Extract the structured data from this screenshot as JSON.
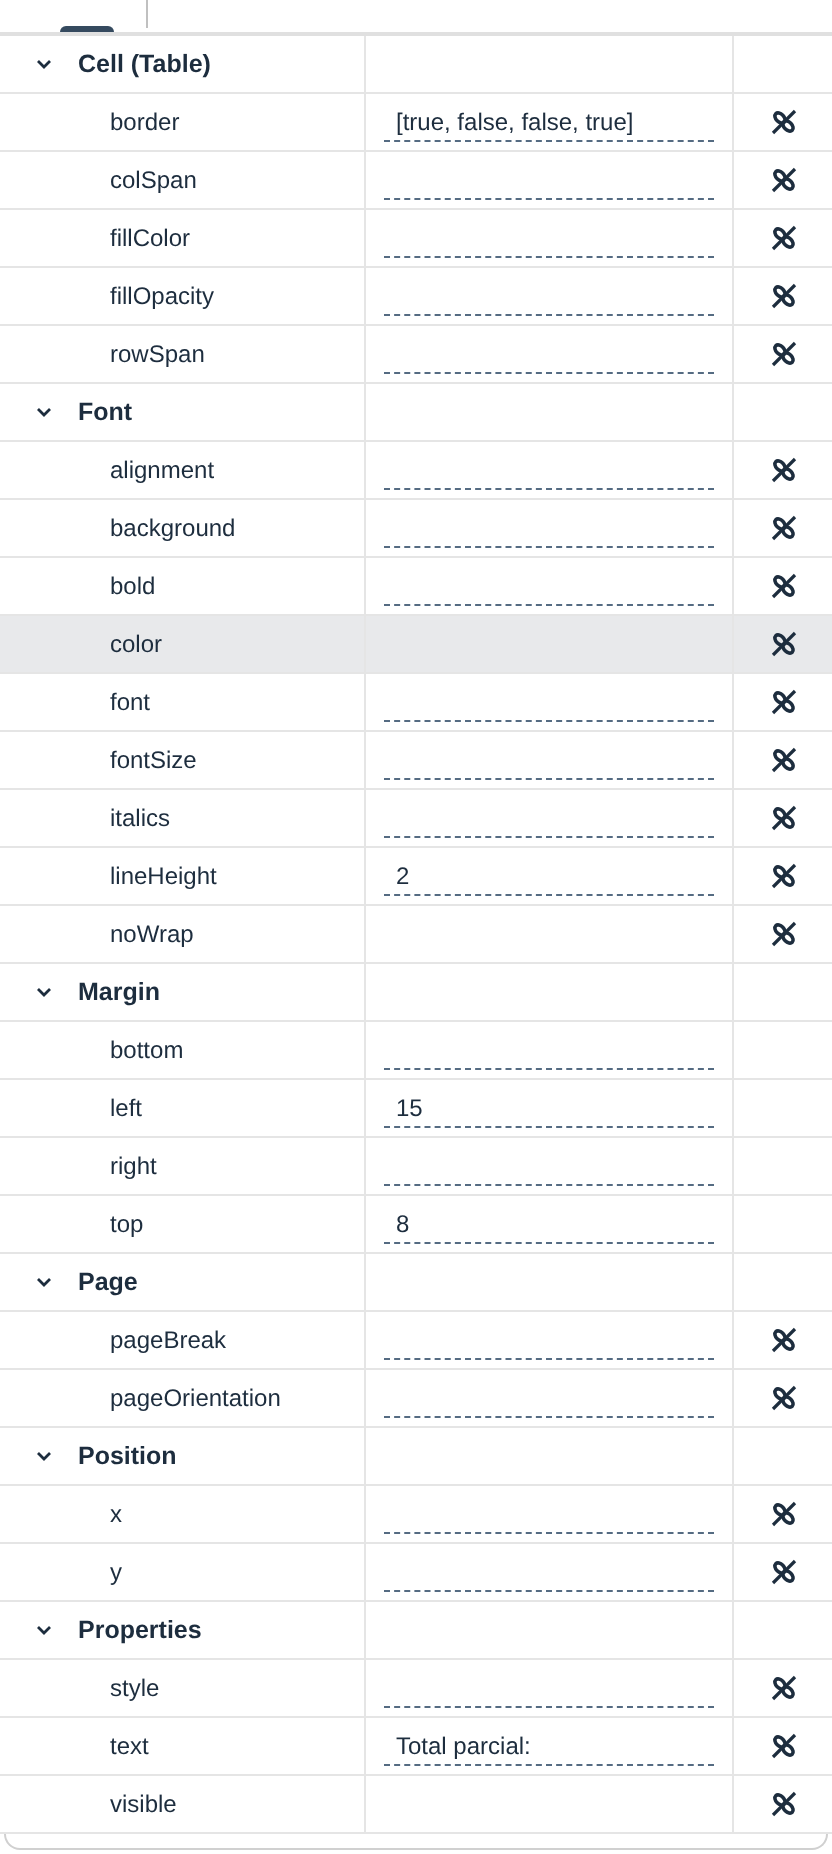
{
  "groups": [
    {
      "title": "Cell (Table)",
      "expanded": true,
      "properties": [
        {
          "name": "border",
          "kind": "field",
          "value": "[true, false, false, true]",
          "bound": true,
          "selected": false
        },
        {
          "name": "colSpan",
          "kind": "field",
          "bound": true,
          "selected": false
        },
        {
          "name": "fillColor",
          "kind": "field",
          "bound": true,
          "selected": false
        },
        {
          "name": "fillOpacity",
          "kind": "field",
          "bound": true,
          "selected": false
        },
        {
          "name": "rowSpan",
          "kind": "field",
          "bound": true,
          "selected": false
        }
      ]
    },
    {
      "title": "Font",
      "expanded": true,
      "properties": [
        {
          "name": "alignment",
          "kind": "field",
          "bound": true,
          "selected": false
        },
        {
          "name": "background",
          "kind": "field",
          "bound": true,
          "selected": false
        },
        {
          "name": "bold",
          "kind": "field",
          "bound": true,
          "selected": false
        },
        {
          "name": "color",
          "kind": "plain",
          "bound": true,
          "selected": true
        },
        {
          "name": "font",
          "kind": "field",
          "bound": true,
          "selected": false
        },
        {
          "name": "fontSize",
          "kind": "field",
          "bound": true,
          "selected": false
        },
        {
          "name": "italics",
          "kind": "field",
          "bound": true,
          "selected": false
        },
        {
          "name": "lineHeight",
          "kind": "field",
          "value": "2",
          "bound": true,
          "selected": false
        },
        {
          "name": "noWrap",
          "kind": "plain",
          "bound": true,
          "selected": false
        }
      ]
    },
    {
      "title": "Margin",
      "expanded": true,
      "properties": [
        {
          "name": "bottom",
          "kind": "field",
          "bound": false,
          "selected": false
        },
        {
          "name": "left",
          "kind": "field",
          "value": "15",
          "bound": false,
          "selected": false
        },
        {
          "name": "right",
          "kind": "field",
          "bound": false,
          "selected": false
        },
        {
          "name": "top",
          "kind": "field",
          "value": "8",
          "bound": false,
          "selected": false
        }
      ]
    },
    {
      "title": "Page",
      "expanded": true,
      "properties": [
        {
          "name": "pageBreak",
          "kind": "field",
          "bound": true,
          "selected": false
        },
        {
          "name": "pageOrientation",
          "kind": "field",
          "bound": true,
          "selected": false
        }
      ]
    },
    {
      "title": "Position",
      "expanded": true,
      "properties": [
        {
          "name": "x",
          "kind": "field",
          "bound": true,
          "selected": false
        },
        {
          "name": "y",
          "kind": "field",
          "bound": true,
          "selected": false
        }
      ]
    },
    {
      "title": "Properties",
      "expanded": true,
      "properties": [
        {
          "name": "style",
          "kind": "field",
          "bound": true,
          "selected": false
        },
        {
          "name": "text",
          "kind": "field",
          "value": "Total parcial:",
          "bound": true,
          "selected": false
        },
        {
          "name": "visible",
          "kind": "plain",
          "bound": true,
          "selected": false
        }
      ]
    }
  ]
}
